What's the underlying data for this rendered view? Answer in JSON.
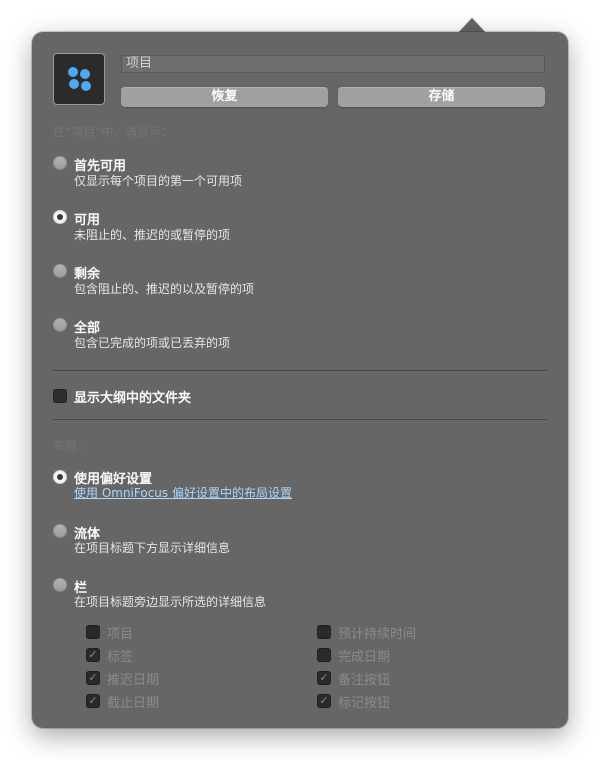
{
  "header": {
    "name_value": "项目",
    "restore_label": "恢复",
    "save_label": "存储"
  },
  "show_section": {
    "heading": "在“项目”中，请显示：",
    "options": [
      {
        "title": "首先可用",
        "desc": "仅显示每个项目的第一个可用项",
        "selected": false
      },
      {
        "title": "可用",
        "desc": "未阻止的、推迟的或暂停的项",
        "selected": true
      },
      {
        "title": "剩余",
        "desc": "包含阻止的、推迟的以及暂停的项",
        "selected": false
      },
      {
        "title": "全部",
        "desc": "包含已完成的项或已丢弃的项",
        "selected": false
      }
    ]
  },
  "folders_checkbox": {
    "label": "显示大纲中的文件夹",
    "checked": false
  },
  "layout_section": {
    "heading": "布局：",
    "options": [
      {
        "title": "使用偏好设置",
        "desc": "使用 OmniFocus 偏好设置中的布局设置",
        "selected": true
      },
      {
        "title": "流体",
        "desc": "在项目标题下方显示详细信息",
        "selected": false
      },
      {
        "title": "栏",
        "desc": "在项目标题旁边显示所选的详细信息",
        "selected": false
      }
    ]
  },
  "columns": {
    "left": [
      {
        "label": "项目",
        "checked": false
      },
      {
        "label": "标签",
        "checked": true
      },
      {
        "label": "推迟日期",
        "checked": true
      },
      {
        "label": "截止日期",
        "checked": true
      }
    ],
    "right": [
      {
        "label": "预计持续时间",
        "checked": false
      },
      {
        "label": "完成日期",
        "checked": false
      },
      {
        "label": "备注按钮",
        "checked": true
      },
      {
        "label": "标记按钮",
        "checked": true
      }
    ]
  },
  "colors": {
    "panel": "#666666",
    "accent_icon": "#4fa8f0",
    "link": "#a8d8ff"
  },
  "icons": {
    "perspective": "blue-dots-perspective-icon",
    "check": "checkmark-icon"
  }
}
